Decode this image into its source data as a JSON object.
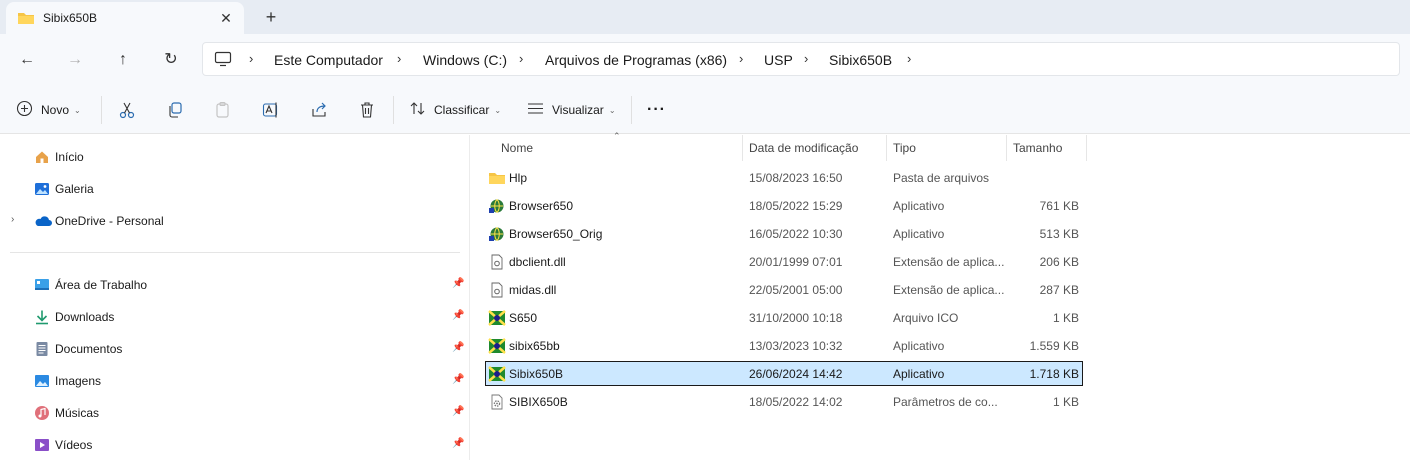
{
  "tab": {
    "title": "Sibix650B",
    "close": "✕",
    "new_tab": "+"
  },
  "nav": {
    "back": "←",
    "forward": "→",
    "up": "↑",
    "refresh": "↻"
  },
  "breadcrumbs": [
    "Este Computador",
    "Windows (C:)",
    "Arquivos de Programas (x86)",
    "USP",
    "Sibix650B"
  ],
  "commands": {
    "new": "Novo",
    "sort": "Classificar",
    "view": "Visualizar",
    "more": "···"
  },
  "sidebar": {
    "top": [
      {
        "label": "Início",
        "icon": "home-icon"
      },
      {
        "label": "Galeria",
        "icon": "gallery-icon"
      },
      {
        "label": "OneDrive - Personal",
        "icon": "onedrive-icon",
        "expandable": true
      }
    ],
    "pinned": [
      {
        "label": "Área de Trabalho",
        "icon": "desktop-icon"
      },
      {
        "label": "Downloads",
        "icon": "downloads-icon"
      },
      {
        "label": "Documentos",
        "icon": "documents-icon"
      },
      {
        "label": "Imagens",
        "icon": "pictures-icon"
      },
      {
        "label": "Músicas",
        "icon": "music-icon"
      },
      {
        "label": "Vídeos",
        "icon": "videos-icon"
      }
    ]
  },
  "columns": {
    "name": "Nome",
    "date": "Data de modificação",
    "type": "Tipo",
    "size": "Tamanho"
  },
  "files": [
    {
      "name": "Hlp",
      "date": "15/08/2023 16:50",
      "type": "Pasta de arquivos",
      "size": "",
      "icon": "folder-icon"
    },
    {
      "name": "Browser650",
      "date": "18/05/2022 15:29",
      "type": "Aplicativo",
      "size": "761 KB",
      "icon": "app-globe-icon"
    },
    {
      "name": "Browser650_Orig",
      "date": "16/05/2022 10:30",
      "type": "Aplicativo",
      "size": "513 KB",
      "icon": "app-globe-icon"
    },
    {
      "name": "dbclient.dll",
      "date": "20/01/1999 07:01",
      "type": "Extensão de aplica...",
      "size": "206 KB",
      "icon": "dll-icon"
    },
    {
      "name": "midas.dll",
      "date": "22/05/2001 05:00",
      "type": "Extensão de aplica...",
      "size": "287 KB",
      "icon": "dll-icon"
    },
    {
      "name": "S650",
      "date": "31/10/2000 10:18",
      "type": "Arquivo ICO",
      "size": "1 KB",
      "icon": "sibix-icon"
    },
    {
      "name": "sibix65bb",
      "date": "13/03/2023 10:32",
      "type": "Aplicativo",
      "size": "1.559 KB",
      "icon": "sibix-icon"
    },
    {
      "name": "Sibix650B",
      "date": "26/06/2024 14:42",
      "type": "Aplicativo",
      "size": "1.718 KB",
      "icon": "sibix-icon",
      "selected": true
    },
    {
      "name": "SIBIX650B",
      "date": "18/05/2022 14:02",
      "type": "Parâmetros de co...",
      "size": "1 KB",
      "icon": "settings-file-icon"
    }
  ],
  "colors": {
    "accent": "#0067c0",
    "selection": "#cce8ff",
    "folder": "#f6c546"
  }
}
